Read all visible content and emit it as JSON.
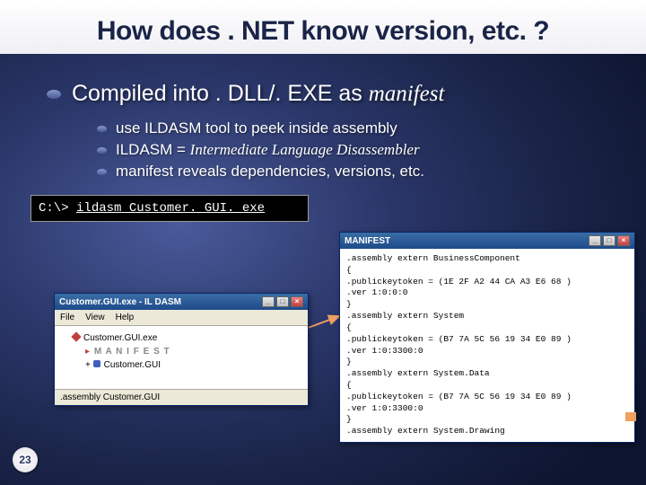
{
  "title": "How does . NET know version, etc. ?",
  "heading_prefix": "Compiled into . DLL/. EXE as ",
  "heading_italic": "manifest",
  "sub": [
    {
      "text": "use ILDASM tool to peek inside assembly"
    },
    {
      "prefix": "ILDASM = ",
      "italic": "Intermediate Language Disassembler"
    },
    {
      "text": "manifest reveals dependencies, versions, etc."
    }
  ],
  "cmd": {
    "prompt": "C:\\>",
    "exe": "ildasm",
    "arg": " Customer. GUI. exe"
  },
  "win1": {
    "title": "Customer.GUI.exe - IL DASM",
    "menu": [
      "File",
      "View",
      "Help"
    ],
    "tree": [
      {
        "icon": "diamond",
        "label": "Customer.GUI.exe"
      },
      {
        "icon": "red",
        "label": "M A N I F E S T",
        "bold": true
      },
      {
        "icon": "blue",
        "label": "Customer.GUI"
      }
    ],
    "status": ".assembly Customer.GUI"
  },
  "win2": {
    "title": "MANIFEST",
    "lines": [
      ".assembly extern BusinessComponent",
      "{",
      "  .publickeytoken = (1E 2F A2 44 CA A3 E6 68 )",
      "  .ver 1:0:0:0",
      "}",
      ".assembly extern System",
      "{",
      "  .publickeytoken = (B7 7A 5C 56 19 34 E0 89 )",
      "  .ver 1:0:3300:0",
      "}",
      ".assembly extern System.Data",
      "{",
      "  .publickeytoken = (B7 7A 5C 56 19 34 E0 89 )",
      "  .ver 1:0:3300:0",
      "}",
      ".assembly extern System.Drawing"
    ]
  },
  "page": "23"
}
